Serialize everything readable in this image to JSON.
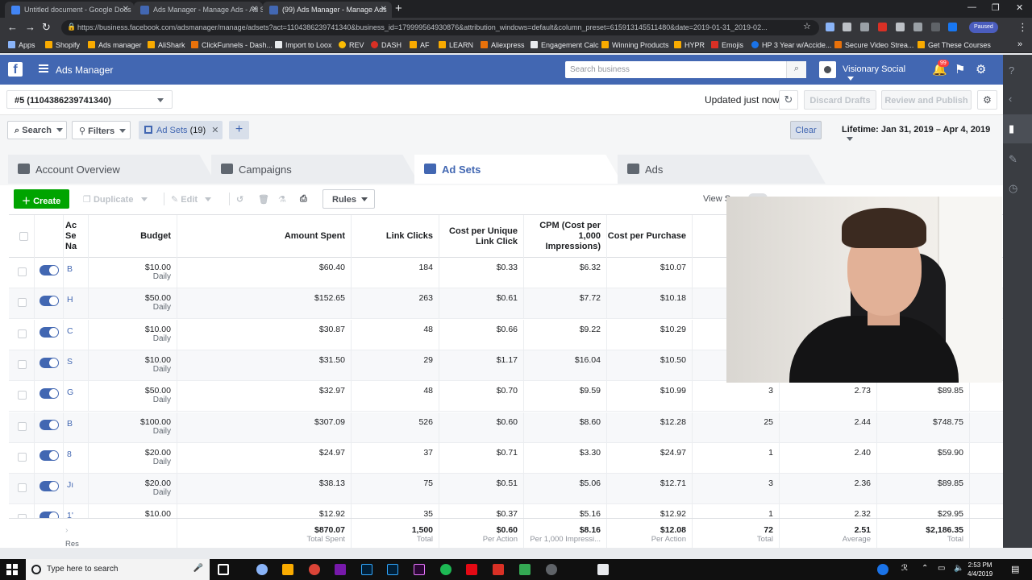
{
  "browser": {
    "tabs": [
      {
        "title": "Untitled document - Google Docs",
        "color": "#4285f4"
      },
      {
        "title": "Ads Manager - Manage Ads - Ad Sets",
        "color": "#4267b2"
      },
      {
        "title": "(99) Ads Manager - Manage Ads",
        "color": "#4267b2"
      }
    ],
    "url": "https://business.facebook.com/adsmanager/manage/adsets?act=1104386239741340&business_id=179999564930876&attribution_windows=default&column_preset=615913145511480&date=2019-01-31_2019-02...",
    "paused_label": "Paused",
    "bookmarks": [
      "Apps",
      "Shopify",
      "Ads manager",
      "AliShark",
      "ClickFunnels - Dash...",
      "Import to Loox",
      "REV",
      "DASH",
      "AF",
      "LEARN",
      "Aliexpress",
      "Engagement Calc",
      "Winning Products",
      "HYPR",
      "Emojis",
      "HP 3 Year w/Accide...",
      "Secure Video Strea...",
      "Get These Courses"
    ]
  },
  "header": {
    "app_name": "Ads Manager",
    "search_placeholder": "Search business",
    "business_name": "Visionary Social",
    "notif_count": "99"
  },
  "account": {
    "selector": "#5 (1104386239741340)",
    "updated": "Updated just now",
    "discard": "Discard Drafts",
    "review": "Review and Publish"
  },
  "filters": {
    "search": "Search",
    "filters": "Filters",
    "chip_label": "Ad Sets",
    "chip_count": "(19)",
    "clear": "Clear",
    "date_range": "Lifetime: Jan 31, 2019 – Apr 4, 2019"
  },
  "level_tabs": {
    "overview": "Account Overview",
    "campaigns": "Campaigns",
    "adsets": "Ad Sets",
    "ads": "Ads"
  },
  "toolbar": {
    "create": "Create",
    "duplicate": "Duplicate",
    "edit": "Edit",
    "rules": "Rules",
    "view_setup": "View Se"
  },
  "table": {
    "headers": {
      "name": [
        "Ac",
        "Se",
        "Na"
      ],
      "budget": "Budget",
      "amount_spent": "Amount Spent",
      "link_clicks": "Link Clicks",
      "cpulc": [
        "Cost per Unique",
        "Link Click"
      ],
      "cpm": [
        "CPM (Cost per",
        "1,000",
        "Impressions)"
      ],
      "cpp": "Cost per Purchase"
    },
    "rows": [
      {
        "name": "B",
        "budget": "$10.00",
        "budget_type": "Daily",
        "spent": "$60.40",
        "clicks": "184",
        "cpulc": "$0.33",
        "cpm": "$6.32",
        "cpp": "$10.07",
        "purchases": "",
        "roas": "",
        "value": ""
      },
      {
        "name": "H",
        "budget": "$50.00",
        "budget_type": "Daily",
        "spent": "$152.65",
        "clicks": "263",
        "cpulc": "$0.61",
        "cpm": "$7.72",
        "cpp": "$10.18",
        "purchases": "",
        "roas": "",
        "value": ""
      },
      {
        "name": "C",
        "budget": "$10.00",
        "budget_type": "Daily",
        "spent": "$30.87",
        "clicks": "48",
        "cpulc": "$0.66",
        "cpm": "$9.22",
        "cpp": "$10.29",
        "purchases": "",
        "roas": "",
        "value": ""
      },
      {
        "name": "S",
        "budget": "$10.00",
        "budget_type": "Daily",
        "spent": "$31.50",
        "clicks": "29",
        "cpulc": "$1.17",
        "cpm": "$16.04",
        "cpp": "$10.50",
        "purchases": "",
        "roas": "",
        "value": ""
      },
      {
        "name": "G",
        "budget": "$50.00",
        "budget_type": "Daily",
        "spent": "$32.97",
        "clicks": "48",
        "cpulc": "$0.70",
        "cpm": "$9.59",
        "cpp": "$10.99",
        "purchases": "3",
        "roas": "2.73",
        "value": "$89.85"
      },
      {
        "name": "B",
        "budget": "$100.00",
        "budget_type": "Daily",
        "spent": "$307.09",
        "clicks": "526",
        "cpulc": "$0.60",
        "cpm": "$8.60",
        "cpp": "$12.28",
        "purchases": "25",
        "roas": "2.44",
        "value": "$748.75"
      },
      {
        "name": "8",
        "budget": "$20.00",
        "budget_type": "Daily",
        "spent": "$24.97",
        "clicks": "37",
        "cpulc": "$0.71",
        "cpm": "$3.30",
        "cpp": "$24.97",
        "purchases": "1",
        "roas": "2.40",
        "value": "$59.90"
      },
      {
        "name": "Jı",
        "budget": "$20.00",
        "budget_type": "Daily",
        "spent": "$38.13",
        "clicks": "75",
        "cpulc": "$0.51",
        "cpm": "$5.06",
        "cpp": "$12.71",
        "purchases": "3",
        "roas": "2.36",
        "value": "$89.85"
      },
      {
        "name": "1'",
        "budget": "$10.00",
        "budget_type": "",
        "spent": "$12.92",
        "clicks": "35",
        "cpulc": "$0.37",
        "cpm": "$5.16",
        "cpp": "$12.92",
        "purchases": "1",
        "roas": "2.32",
        "value": "$29.95"
      }
    ],
    "footer": {
      "label": "Res",
      "spent": "$870.07",
      "spent_sub": "Total Spent",
      "clicks": "1,500",
      "clicks_sub": "Total",
      "cpulc": "$0.60",
      "cpulc_sub": "Per Action",
      "cpm": "$8.16",
      "cpm_sub": "Per 1,000 Impressi...",
      "cpp": "$12.08",
      "cpp_sub": "Per Action",
      "purchases": "72",
      "purchases_sub": "Total",
      "roas": "2.51",
      "roas_sub": "Average",
      "value": "$2,186.35",
      "value_sub": "Total"
    }
  },
  "taskbar": {
    "search_placeholder": "Type here to search",
    "time": "2:53 PM",
    "date": "4/4/2019"
  },
  "colors": {
    "fb_blue": "#4267b2",
    "create_green": "#00a400"
  }
}
